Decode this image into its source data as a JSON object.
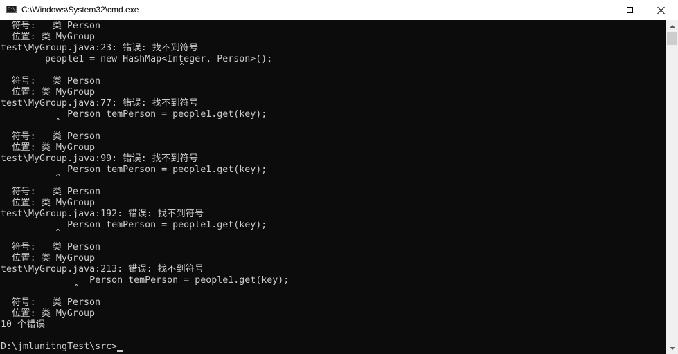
{
  "window": {
    "title": "C:\\Windows\\System32\\cmd.exe",
    "icon": "cmd-icon",
    "controls": {
      "minimize": "minimize-icon",
      "maximize": "maximize-icon",
      "close": "close-icon"
    }
  },
  "console": {
    "lines": [
      "  符号:   类 Person",
      "  位置: 类 MyGroup",
      "test\\MyGroup.java:23: 错误: 找不到符号",
      "        people1 = new HashMap<Integer, Person>();",
      "                                       ^",
      "  符号:   类 Person",
      "  位置: 类 MyGroup",
      "test\\MyGroup.java:77: 错误: 找不到符号",
      "            Person temPerson = people1.get(key);",
      "            ^",
      "  符号:   类 Person",
      "  位置: 类 MyGroup",
      "test\\MyGroup.java:99: 错误: 找不到符号",
      "            Person temPerson = people1.get(key);",
      "            ^",
      "  符号:   类 Person",
      "  位置: 类 MyGroup",
      "test\\MyGroup.java:192: 错误: 找不到符号",
      "            Person temPerson = people1.get(key);",
      "            ^",
      "  符号:   类 Person",
      "  位置: 类 MyGroup",
      "test\\MyGroup.java:213: 错误: 找不到符号",
      "                Person temPerson = people1.get(key);",
      "                ^",
      "  符号:   类 Person",
      "  位置: 类 MyGroup",
      "10 个错误",
      "",
      "D:\\jmlunitngTest\\src>"
    ]
  },
  "scrollbar": {
    "up_icon": "▲",
    "down_icon": "▼",
    "position_fraction": 0.0
  }
}
